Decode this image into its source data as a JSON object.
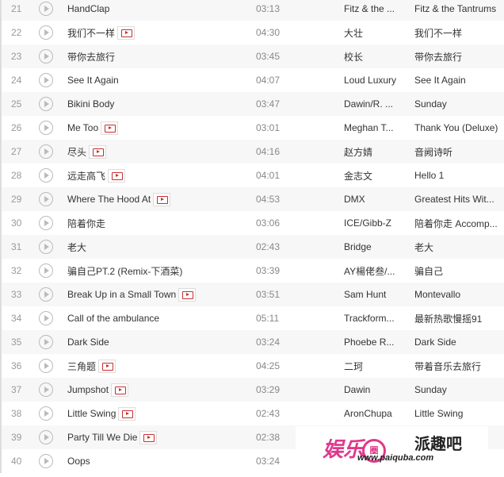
{
  "tracks": [
    {
      "num": "21",
      "title": "HandClap",
      "mv": false,
      "duration": "03:13",
      "artist": "Fitz & the ...",
      "album": "Fitz & the Tantrums"
    },
    {
      "num": "22",
      "title": "我们不一样",
      "mv": true,
      "duration": "04:30",
      "artist": "大壮",
      "album": "我们不一样"
    },
    {
      "num": "23",
      "title": "带你去旅行",
      "mv": false,
      "duration": "03:45",
      "artist": "校长",
      "album": "带你去旅行"
    },
    {
      "num": "24",
      "title": "See It Again",
      "mv": false,
      "duration": "04:07",
      "artist": "Loud Luxury",
      "album": "See It Again"
    },
    {
      "num": "25",
      "title": "Bikini Body",
      "mv": false,
      "duration": "03:47",
      "artist": "Dawin/R. ...",
      "album": "Sunday"
    },
    {
      "num": "26",
      "title": "Me Too",
      "mv": true,
      "duration": "03:01",
      "artist": "Meghan T...",
      "album": "Thank You (Deluxe)"
    },
    {
      "num": "27",
      "title": "尽头",
      "mv": true,
      "duration": "04:16",
      "artist": "赵方婧",
      "album": "音阙诗听"
    },
    {
      "num": "28",
      "title": "远走高飞",
      "mv": true,
      "duration": "04:01",
      "artist": "金志文",
      "album": "Hello 1"
    },
    {
      "num": "29",
      "title": "Where The Hood At",
      "mv": true,
      "duration": "04:53",
      "artist": "DMX",
      "album": "Greatest Hits Wit..."
    },
    {
      "num": "30",
      "title": "陪着你走",
      "mv": false,
      "duration": "03:06",
      "artist": "ICE/Gibb-Z",
      "album": "陪着你走 Accomp..."
    },
    {
      "num": "31",
      "title": "老大",
      "mv": false,
      "duration": "02:43",
      "artist": "Bridge",
      "album": "老大"
    },
    {
      "num": "32",
      "title": "骗自己PT.2 (Remix-下酒菜)",
      "mv": false,
      "duration": "03:39",
      "artist": "AY楊佬叁/...",
      "album": "骗自己"
    },
    {
      "num": "33",
      "title": "Break Up in a Small Town",
      "mv": true,
      "duration": "03:51",
      "artist": "Sam Hunt",
      "album": "Montevallo"
    },
    {
      "num": "34",
      "title": "Call of the ambulance",
      "mv": false,
      "duration": "05:11",
      "artist": "Trackform...",
      "album": "最新热歌慢摇91"
    },
    {
      "num": "35",
      "title": "Dark Side",
      "mv": false,
      "duration": "03:24",
      "artist": "Phoebe R...",
      "album": "Dark Side"
    },
    {
      "num": "36",
      "title": "三角题",
      "mv": true,
      "duration": "04:25",
      "artist": "二珂",
      "album": "带着音乐去旅行"
    },
    {
      "num": "37",
      "title": "Jumpshot",
      "mv": true,
      "duration": "03:29",
      "artist": "Dawin",
      "album": "Sunday"
    },
    {
      "num": "38",
      "title": "Little Swing",
      "mv": true,
      "duration": "02:43",
      "artist": "AronChupa",
      "album": "Little Swing"
    },
    {
      "num": "39",
      "title": "Party Till We Die",
      "mv": true,
      "duration": "02:38",
      "artist": "",
      "album": ""
    },
    {
      "num": "40",
      "title": "Oops",
      "mv": false,
      "duration": "03:24",
      "artist": "",
      "album": ""
    }
  ],
  "watermark": {
    "logo": "娱乐圈",
    "site_name": "派趣吧",
    "url": "www.paiquba.com"
  },
  "colors": {
    "accent": "#c62f2f",
    "row_alt": "#f7f7f7",
    "watermark_pink": "#e0388c"
  }
}
